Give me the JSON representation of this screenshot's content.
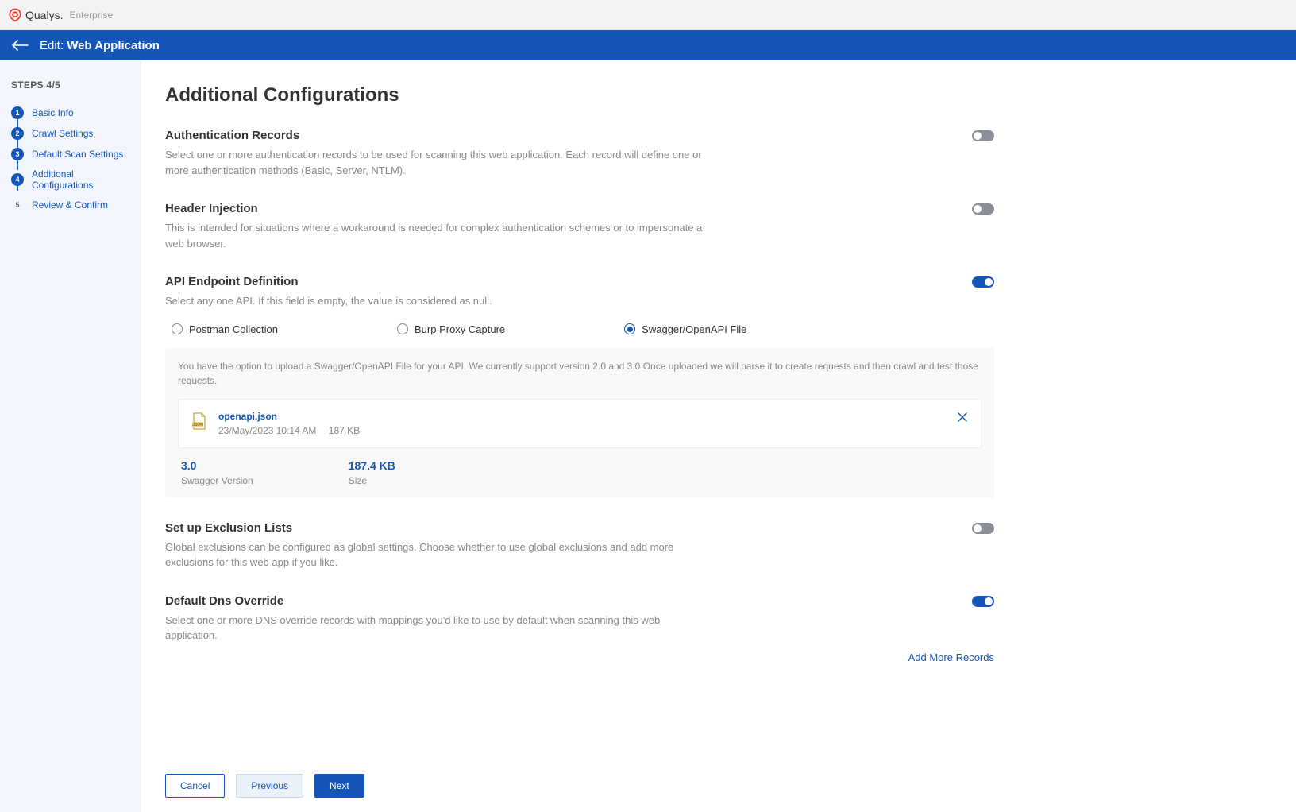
{
  "brand": {
    "name": "Qualys.",
    "sub": "Enterprise"
  },
  "header": {
    "prefix": "Edit:",
    "title": "Web Application"
  },
  "sidebar": {
    "steps_label": "STEPS 4/5",
    "items": [
      {
        "num": "1",
        "label": "Basic Info"
      },
      {
        "num": "2",
        "label": "Crawl Settings"
      },
      {
        "num": "3",
        "label": "Default Scan Settings"
      },
      {
        "num": "4",
        "label": "Additional Configurations"
      },
      {
        "num": "5",
        "label": "Review & Confirm"
      }
    ]
  },
  "main": {
    "title": "Additional Configurations",
    "sections": {
      "auth": {
        "title": "Authentication Records",
        "desc": "Select one or more authentication records to be used for scanning this web application. Each record will define one or more authentication methods (Basic, Server, NTLM)."
      },
      "header_inj": {
        "title": "Header Injection",
        "desc": "This is intended for situations where a workaround is needed for complex authentication schemes or to impersonate a web browser."
      },
      "api": {
        "title": "API Endpoint Definition",
        "desc": "Select any one API. If this field is empty, the value is considered as null.",
        "options": {
          "postman": "Postman Collection",
          "burp": "Burp Proxy Capture",
          "swagger": "Swagger/OpenAPI File"
        },
        "note": "You have the option to upload a Swagger/OpenAPI File for your API. We currently support version 2.0 and 3.0 Once uploaded we will parse it to create requests and then crawl and test those requests.",
        "file": {
          "name": "openapi.json",
          "date": "23/May/2023 10:14 AM",
          "size_inline": "187 KB",
          "version_val": "3.0",
          "version_lbl": "Swagger Version",
          "size_val": "187.4 KB",
          "size_lbl": "Size"
        }
      },
      "excl": {
        "title": "Set up Exclusion Lists",
        "desc": "Global exclusions can be configured as global settings. Choose whether to use global exclusions and add more exclusions for this web app if you like."
      },
      "dns": {
        "title": "Default Dns Override",
        "desc": "Select one or more DNS override records with mappings you'd like to use by default when scanning this web application.",
        "link": "Add More Records"
      }
    }
  },
  "footer": {
    "cancel": "Cancel",
    "previous": "Previous",
    "next": "Next"
  }
}
